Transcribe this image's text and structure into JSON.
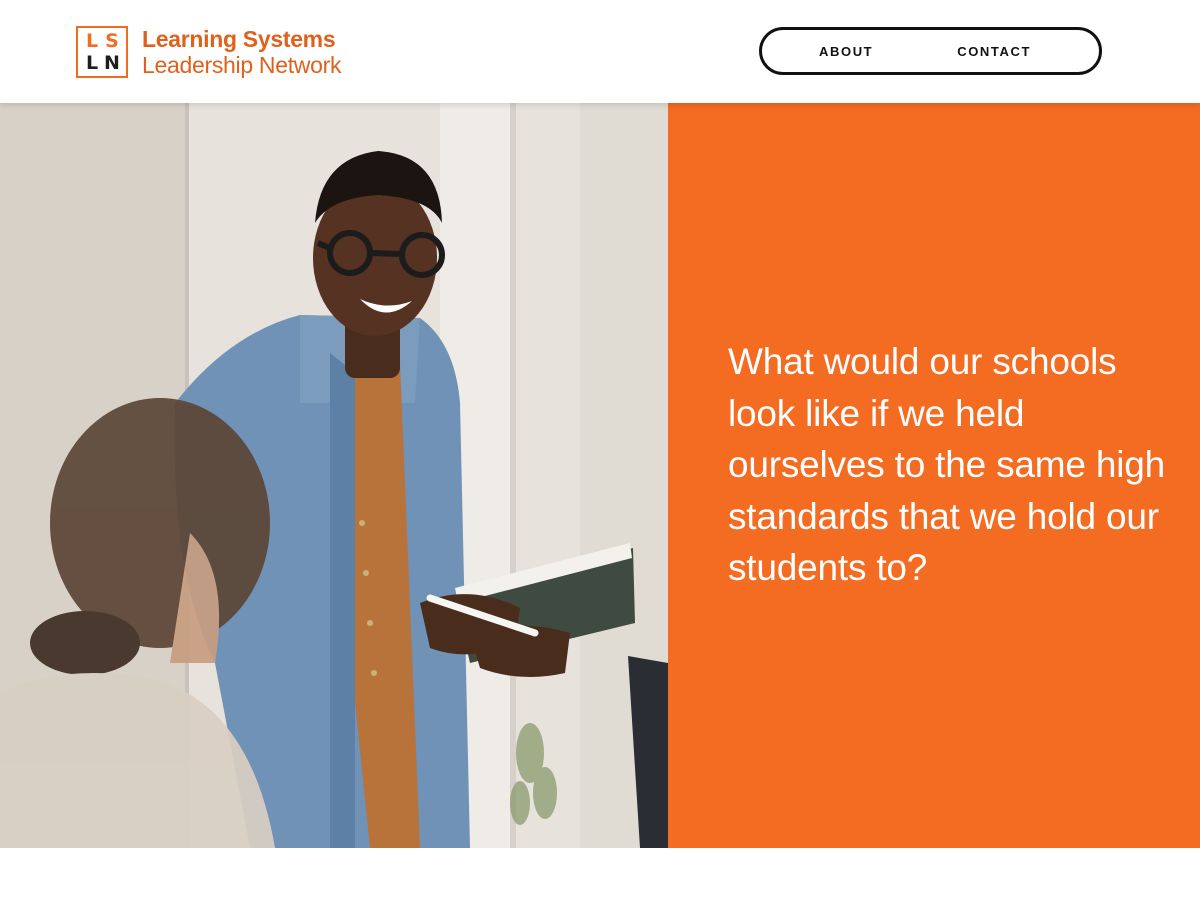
{
  "brand": {
    "logo_mark": [
      "L",
      "S",
      "L",
      "N"
    ],
    "name_line1": "Learning Systems",
    "name_line2": "Leadership Network",
    "accent": "#F46B22",
    "text_dark": "#111111"
  },
  "nav": {
    "items": [
      {
        "label": "ABOUT"
      },
      {
        "label": "CONTACT"
      }
    ]
  },
  "hero": {
    "quote": "What would our schools look like if we held ourselves to the same high standards that we hold our students to?",
    "photo_icon": "teacher-photo"
  },
  "intro": {
    "text": ""
  }
}
